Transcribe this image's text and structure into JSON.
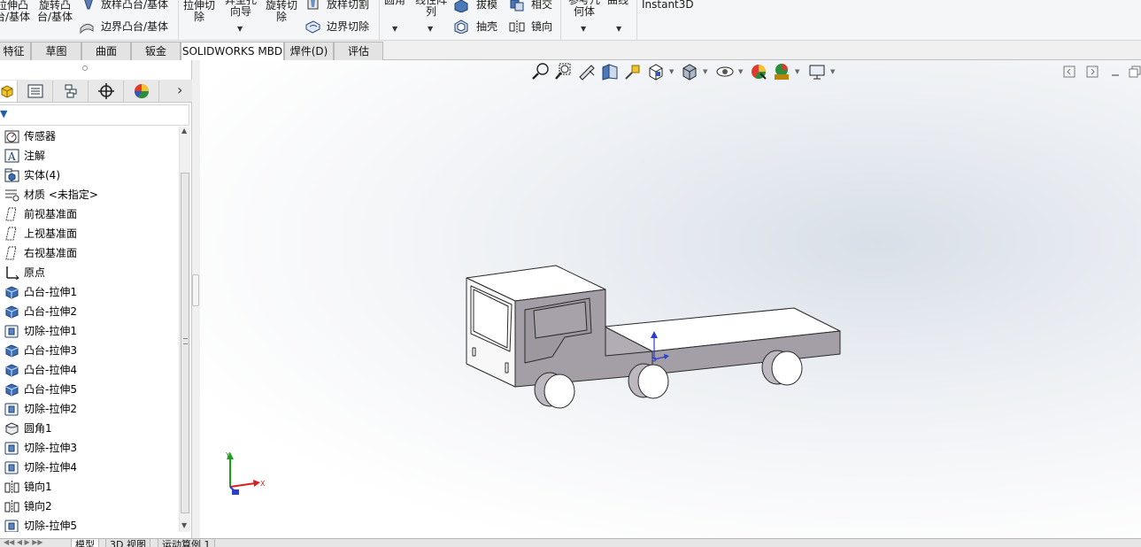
{
  "ribbon": {
    "extrude_boss_partial": "拉伸凸\n台/基体",
    "revolve_boss_partial": "旋转凸\n台/基体",
    "loft_boss": "放样凸台/基体",
    "boundary_boss": "边界凸台/基体",
    "extrude_cut": "拉伸切\n除",
    "hole_wizard_partial": "异型孔\n向导",
    "revolve_cut": "旋转切\n除",
    "loft_cut": "放样切割",
    "boundary_cut": "边界切除",
    "fillet_partial": "圆角",
    "pattern_partial": "线性阵\n列",
    "draft": "拔模",
    "shell": "抽壳",
    "intersect": "相交",
    "mirror": "镜向",
    "ref_geometry_partial": "参考几\n何体",
    "curves_partial": "曲线",
    "instant3d": "Instant3D"
  },
  "tabs": [
    {
      "label": "特征",
      "active": false
    },
    {
      "label": "草图",
      "active": false
    },
    {
      "label": "曲面",
      "active": false
    },
    {
      "label": "钣金",
      "active": false
    },
    {
      "label": "SOLIDWORKS MBD",
      "active": true
    },
    {
      "label": "焊件(D)",
      "active": false
    },
    {
      "label": "评估",
      "active": false
    }
  ],
  "panel_tabs": [
    {
      "icon": "feature-manager-icon",
      "active": true
    },
    {
      "icon": "property-manager-icon",
      "active": false
    },
    {
      "icon": "configuration-manager-icon",
      "active": false
    },
    {
      "icon": "dimxpert-manager-icon",
      "active": false
    },
    {
      "icon": "display-manager-icon",
      "active": false
    }
  ],
  "panel_more": "›",
  "tree": [
    {
      "label": "传感器",
      "icon": "sensor"
    },
    {
      "label": "注解",
      "icon": "annotation"
    },
    {
      "label": "实体(4)",
      "icon": "solid-bodies"
    },
    {
      "label": "材质 <未指定>",
      "icon": "material"
    },
    {
      "label": "前视基准面",
      "icon": "plane"
    },
    {
      "label": "上视基准面",
      "icon": "plane"
    },
    {
      "label": "右视基准面",
      "icon": "plane"
    },
    {
      "label": "原点",
      "icon": "origin"
    },
    {
      "label": "凸台-拉伸1",
      "icon": "boss-extrude"
    },
    {
      "label": "凸台-拉伸2",
      "icon": "boss-extrude"
    },
    {
      "label": "切除-拉伸1",
      "icon": "cut-extrude"
    },
    {
      "label": "凸台-拉伸3",
      "icon": "boss-extrude"
    },
    {
      "label": "凸台-拉伸4",
      "icon": "boss-extrude"
    },
    {
      "label": "凸台-拉伸5",
      "icon": "boss-extrude"
    },
    {
      "label": "切除-拉伸2",
      "icon": "cut-extrude"
    },
    {
      "label": "圆角1",
      "icon": "fillet"
    },
    {
      "label": "切除-拉伸3",
      "icon": "cut-extrude"
    },
    {
      "label": "切除-拉伸4",
      "icon": "cut-extrude"
    },
    {
      "label": "镜向1",
      "icon": "mirror"
    },
    {
      "label": "镜向2",
      "icon": "mirror"
    },
    {
      "label": "切除-拉伸5",
      "icon": "cut-extrude"
    }
  ],
  "bottom_tabs": [
    {
      "label": "模型",
      "active": true
    },
    {
      "label": "3D 视图",
      "active": false
    },
    {
      "label": "运动算例 1",
      "active": false
    }
  ],
  "triad": {
    "x_label": "X",
    "y_label": "Y"
  },
  "colors": {
    "accent": "#1b5fa8",
    "truck_side": "#a49ea6",
    "truck_top": "#ffffff",
    "axis_x": "#d42020",
    "axis_y": "#18a018",
    "axis_z": "#2a3fd0"
  }
}
